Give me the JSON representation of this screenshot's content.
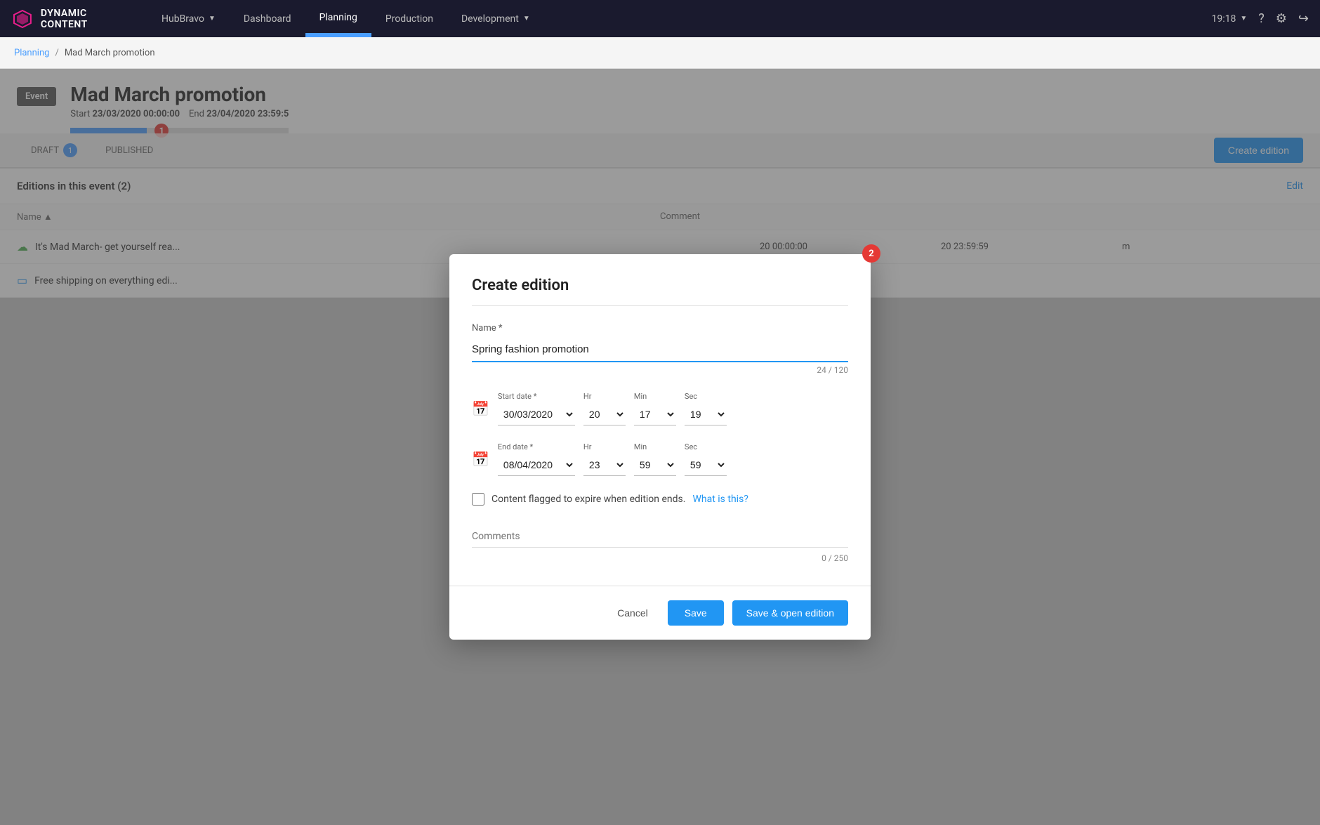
{
  "app": {
    "logo_text": "DYNAMIC CONTENT",
    "time": "19:18"
  },
  "topnav": {
    "workspace": "HubBravo",
    "items": [
      {
        "label": "Dashboard",
        "active": false
      },
      {
        "label": "Planning",
        "active": true
      },
      {
        "label": "Production",
        "active": false
      },
      {
        "label": "Development",
        "active": false
      }
    ],
    "right_icons": [
      "help-icon",
      "settings-icon",
      "logout-icon"
    ]
  },
  "breadcrumb": {
    "parent": "Planning",
    "current": "Mad March promotion"
  },
  "event": {
    "badge": "Event",
    "title": "Mad March promotion",
    "start_label": "Start",
    "start": "23/03/2020 00:00:00",
    "end_label": "End",
    "end": "23/04/2020 23:59:5",
    "step1_label": "1"
  },
  "tabs": {
    "draft_label": "DRAFT",
    "draft_count": "1",
    "published_label": "PUBLISHED",
    "create_edition_btn": "Create edition",
    "edit_link": "Edit"
  },
  "editions": {
    "title": "Editions in this event",
    "count": "2",
    "columns": {
      "name": "Name",
      "comment": "Comment"
    },
    "rows": [
      {
        "status": "published",
        "name": "It's Mad March- get yourself rea...",
        "comment": "",
        "col3": "20 00:00:00",
        "col4": "20 23:59:59",
        "col5": "m"
      },
      {
        "status": "draft",
        "name": "Free shipping on everything edi...",
        "comment": ""
      }
    ]
  },
  "modal": {
    "title": "Create edition",
    "step2_label": "2",
    "name_label": "Name *",
    "name_value": "Spring fashion promotion",
    "name_char_count": "24 / 120",
    "start_date_label": "Start date *",
    "start_date_value": "30/03/2020",
    "start_hr_label": "Hr",
    "start_hr_value": "20",
    "start_min_label": "Min",
    "start_min_value": "17",
    "start_sec_label": "Sec",
    "start_sec_value": "19",
    "end_date_label": "End date *",
    "end_date_value": "08/04/2020",
    "end_hr_label": "Hr",
    "end_hr_value": "23",
    "end_min_label": "Min",
    "end_min_value": "59",
    "end_sec_label": "Sec",
    "end_sec_value": "59",
    "expire_label": "Content flagged to expire when edition ends.",
    "what_is_this": "What is this?",
    "comments_placeholder": "Comments",
    "comments_char_count": "0 / 250",
    "cancel_btn": "Cancel",
    "save_btn": "Save",
    "save_open_btn": "Save & open edition"
  }
}
